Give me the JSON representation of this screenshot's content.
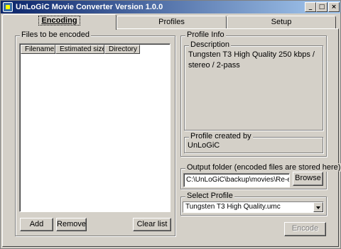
{
  "window": {
    "title": "UnLoGiC Movie Converter Version 1.0.0",
    "controls": {
      "minimize": "_",
      "maximize": "□",
      "close": "×"
    }
  },
  "tabs": [
    {
      "label": "Encoding",
      "active": true
    },
    {
      "label": "Profiles",
      "active": false
    },
    {
      "label": "Setup",
      "active": false
    }
  ],
  "files": {
    "group_label": "Files to be encoded",
    "columns": [
      "Filename",
      "Estimated size",
      "Directory"
    ],
    "rows": [],
    "add_label": "Add",
    "remove_label": "Remove",
    "clear_label": "Clear list"
  },
  "profile_info": {
    "group_label": "Profile Info",
    "description_label": "Description",
    "description": "Tungsten T3 High Quality 250 kbps / stereo / 2-pass",
    "created_by_label": "Profile created by",
    "created_by": "UnLoGiC"
  },
  "output_folder": {
    "group_label": "Output folder (encoded files are stored here)",
    "value": "C:\\UnLoGiC\\backup\\movies\\Re-encode",
    "browse_label": "Browse"
  },
  "select_profile": {
    "group_label": "Select Profile",
    "selected": "Tungsten T3 High Quality.umc"
  },
  "encode_label": "Encode"
}
